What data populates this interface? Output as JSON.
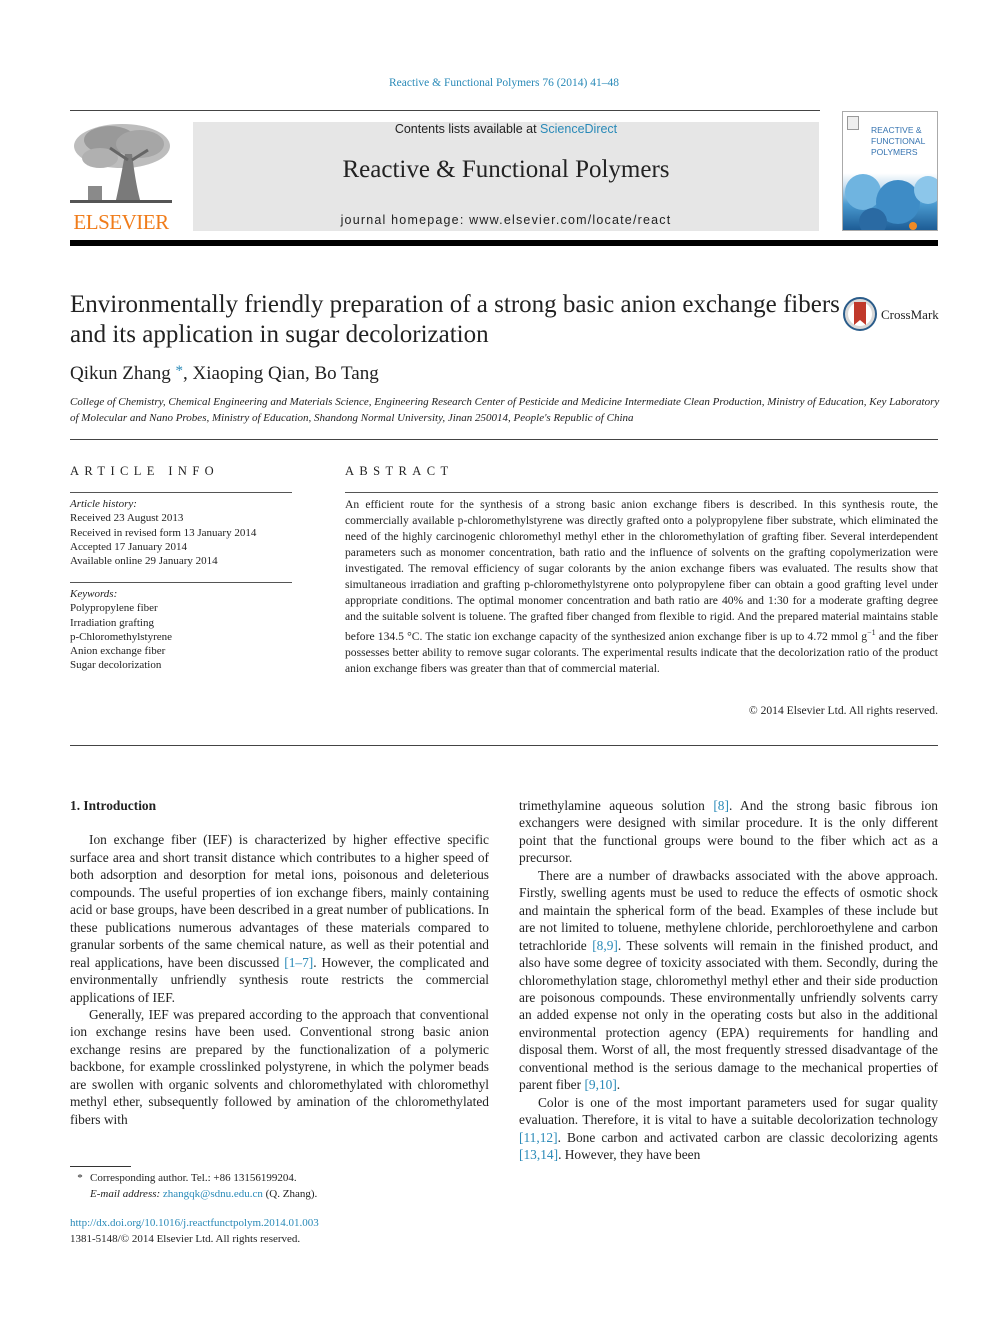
{
  "header": {
    "citation": "Reactive & Functional Polymers 76 (2014) 41–48",
    "contents_prefix": "Contents lists available at ",
    "contents_link": "ScienceDirect",
    "journal_name": "Reactive & Functional Polymers",
    "homepage": "journal homepage: www.elsevier.com/locate/react",
    "publisher_logo_text": "ELSEVIER",
    "cover_title_lines": [
      "REACTIVE &",
      "FUNCTIONAL",
      "POLYMERS"
    ],
    "crossmark_label": "CrossMark"
  },
  "article": {
    "title": "Environmentally friendly preparation of a strong basic anion exchange fibers and its application in sugar decolorization",
    "authors": [
      {
        "name": "Qikun Zhang",
        "mark": "*"
      },
      {
        "name": "Xiaoping Qian",
        "mark": ""
      },
      {
        "name": "Bo Tang",
        "mark": ""
      }
    ],
    "affiliation": "College of Chemistry, Chemical Engineering and Materials Science, Engineering Research Center of Pesticide and Medicine Intermediate Clean Production, Ministry of Education, Key Laboratory of Molecular and Nano Probes, Ministry of Education, Shandong Normal University, Jinan 250014, People's Republic of China"
  },
  "article_info": {
    "heading": "ARTICLE INFO",
    "history_label": "Article history:",
    "history": [
      "Received 23 August 2013",
      "Received in revised form 13 January 2014",
      "Accepted 17 January 2014",
      "Available online 29 January 2014"
    ],
    "keywords_label": "Keywords:",
    "keywords": [
      "Polypropylene fiber",
      "Irradiation grafting",
      "p-Chloromethylstyrene",
      "Anion exchange fiber",
      "Sugar decolorization"
    ]
  },
  "abstract": {
    "heading": "ABSTRACT",
    "text_before_sup": "An efficient route for the synthesis of a strong basic anion exchange fibers is described. In this synthesis route, the commercially available p-chloromethylstyrene was directly grafted onto a polypropylene fiber substrate, which eliminated the need of the highly carcinogenic chloromethyl methyl ether in the chloromethylation of grafting fiber. Several interdependent parameters such as monomer concentration, bath ratio and the influence of solvents on the grafting copolymerization were investigated. The removal efficiency of sugar colorants by the anion exchange fibers was evaluated. The results show that simultaneous irradiation and grafting p-chloromethylstyrene onto polypropylene fiber can obtain a good grafting level under appropriate conditions. The optimal monomer concentration and bath ratio are 40% and 1:30 for a moderate grafting degree and the suitable solvent is toluene. The grafted fiber changed from flexible to rigid. And the prepared material maintains stable before 134.5 °C. The static ion exchange capacity of the synthesized anion exchange fiber is up to 4.72 mmol g",
    "superscript": "−1",
    "text_after_sup": " and the fiber possesses better ability to remove sugar colorants. The experimental results indicate that the decolorization ratio of the product anion exchange fibers was greater than that of commercial material.",
    "copyright": "© 2014 Elsevier Ltd. All rights reserved."
  },
  "body": {
    "section_heading": "1. Introduction",
    "left_paragraphs": [
      {
        "segments": [
          {
            "text": "Ion exchange fiber (IEF) is characterized by higher effective specific surface area and short transit distance which contributes to a higher speed of both adsorption and desorption for metal ions, poisonous and deleterious compounds. The useful properties of ion exchange fibers, mainly containing acid or base groups, have been described in a great number of publications. In these publications numerous advantages of these materials compared to granular sorbents of the same chemical nature, as well as their potential and real applications, have been discussed "
          },
          {
            "text": "[1–7]",
            "ref": true
          },
          {
            "text": ". However, the complicated and environmentally unfriendly synthesis route restricts the commercial applications of IEF."
          }
        ]
      },
      {
        "segments": [
          {
            "text": "Generally, IEF was prepared according to the approach that conventional ion exchange resins have been used. Conventional strong basic anion exchange resins are prepared by the functionalization of a polymeric backbone, for example crosslinked polystyrene, in which the polymer beads are swollen with organic solvents and chloromethylated with chloromethyl methyl ether, subsequently followed by amination of the chloromethylated fibers with"
          }
        ]
      }
    ],
    "right_paragraphs": [
      {
        "continuation": true,
        "segments": [
          {
            "text": "trimethylamine aqueous solution "
          },
          {
            "text": "[8]",
            "ref": true
          },
          {
            "text": ". And the strong basic fibrous ion exchangers were designed with similar procedure. It is the only different point that the functional groups were bound to the fiber which act as a precursor."
          }
        ]
      },
      {
        "segments": [
          {
            "text": "There are a number of drawbacks associated with the above approach. Firstly, swelling agents must be used to reduce the effects of osmotic shock and maintain the spherical form of the bead. Examples of these include but are not limited to toluene, methylene chloride, perchloroethylene and carbon tetrachloride "
          },
          {
            "text": "[8,9]",
            "ref": true
          },
          {
            "text": ". These solvents will remain in the finished product, and also have some degree of toxicity associated with them. Secondly, during the chloromethylation stage, chloromethyl methyl ether and their side production are poisonous compounds. These environmentally unfriendly solvents carry an added expense not only in the operating costs but also in the additional environmental protection agency (EPA) requirements for handling and disposal them. Worst of all, the most frequently stressed disadvantage of the conventional method is the serious damage to the mechanical properties of parent fiber "
          },
          {
            "text": "[9,10]",
            "ref": true
          },
          {
            "text": "."
          }
        ]
      },
      {
        "segments": [
          {
            "text": "Color is one of the most important parameters used for sugar quality evaluation. Therefore, it is vital to have a suitable decolorization technology "
          },
          {
            "text": "[11,12]",
            "ref": true
          },
          {
            "text": ". Bone carbon and activated carbon are classic decolorizing agents "
          },
          {
            "text": "[13,14]",
            "ref": true
          },
          {
            "text": ". However, they have been"
          }
        ]
      }
    ]
  },
  "footnote": {
    "mark": "*",
    "text": "Corresponding author. Tel.: +86 13156199204.",
    "email_label": "E-mail address: ",
    "email": "zhangqk@sdnu.edu.cn",
    "email_suffix": " (Q. Zhang)."
  },
  "doi": {
    "url": "http://dx.doi.org/10.1016/j.reactfunctpolym.2014.01.003",
    "issn_line": "1381-5148/© 2014 Elsevier Ltd. All rights reserved."
  },
  "colors": {
    "link": "#2a8ab8",
    "elsevier_orange": "#f07c1a",
    "masthead_bg": "#e6e6e6"
  }
}
